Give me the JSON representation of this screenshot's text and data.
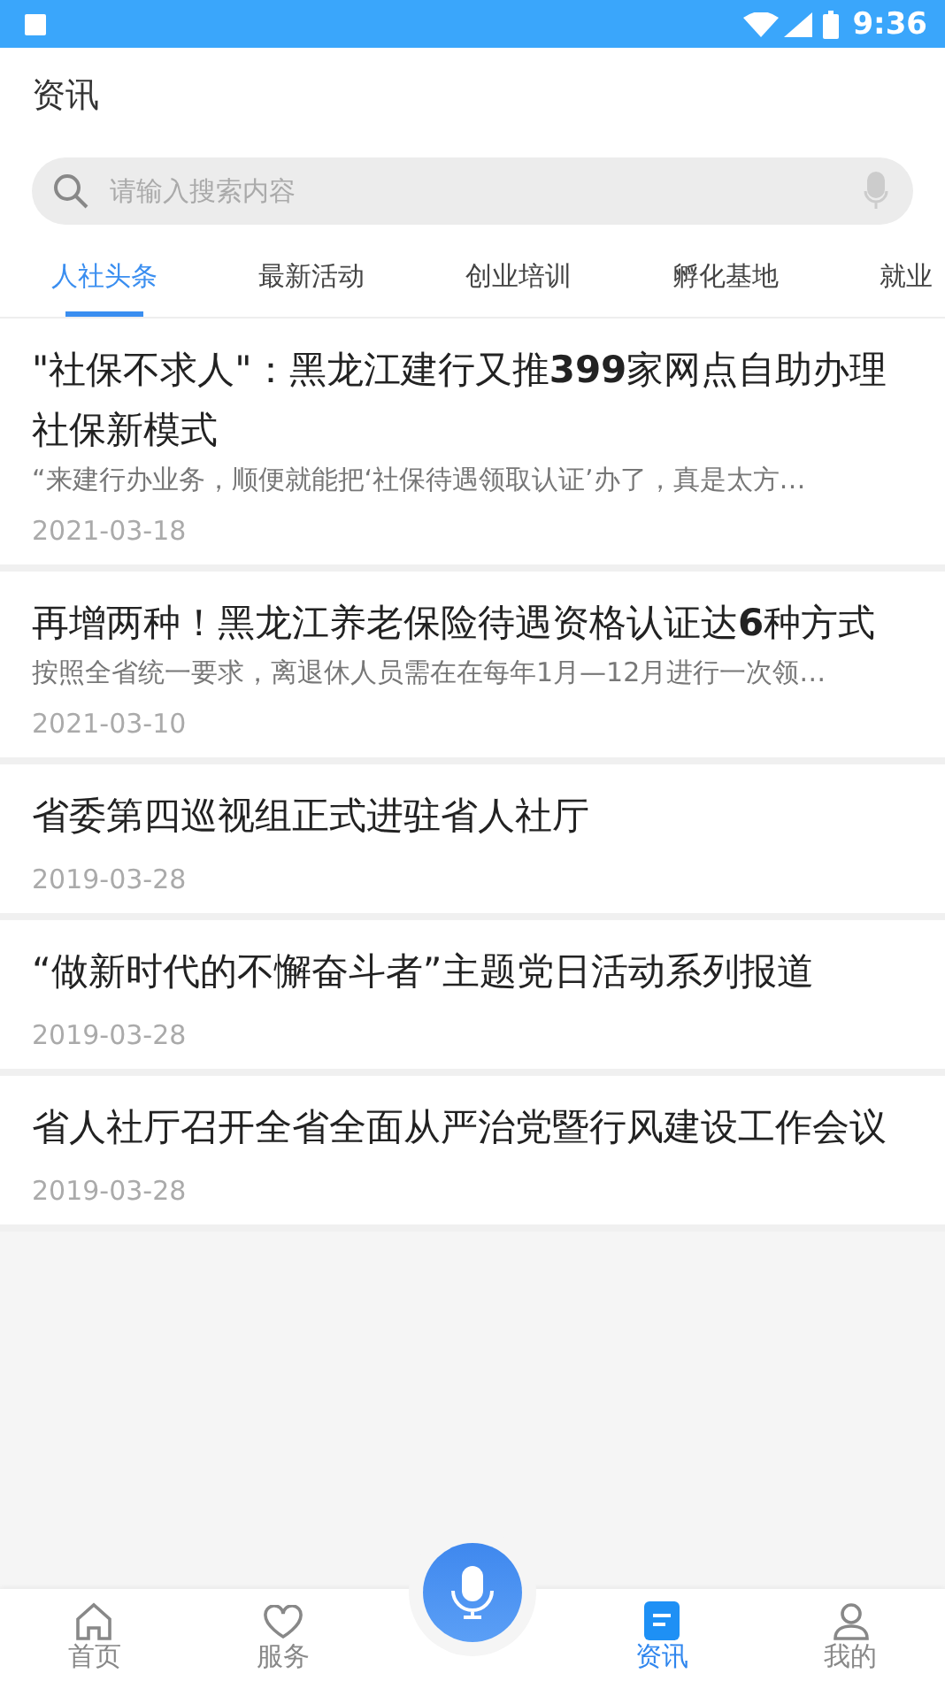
{
  "status_bar": {
    "time": "9:36"
  },
  "header": {
    "title": "资讯"
  },
  "search": {
    "placeholder": "请输入搜索内容"
  },
  "tabs": [
    {
      "label": "人社头条",
      "selected": true
    },
    {
      "label": "最新活动",
      "selected": false
    },
    {
      "label": "创业培训",
      "selected": false
    },
    {
      "label": "孵化基地",
      "selected": false
    },
    {
      "label": "就业",
      "selected": false
    }
  ],
  "articles": [
    {
      "title": "\"社保不求人\"：黑龙江建行又推**399**家网点自助办理社保新模式",
      "snippet": "“来建行办业务，顺便就能把‘社保待遇领取认证’办了，真是太方…",
      "date": "2021-03-18"
    },
    {
      "title": "再增两种！黑龙江养老保险待遇资格认证达**6**种方式",
      "snippet": "按照全省统一要求，离退休人员需在在每年1月—12月进行一次领…",
      "date": "2021-03-10"
    },
    {
      "title": "省委第四巡视组正式进驻省人社厅",
      "date": "2019-03-28"
    },
    {
      "title": "“做新时代的不懈奋斗者”主题党日活动系列报道",
      "date": "2019-03-28"
    },
    {
      "title": "省人社厅召开全省全面从严治党暨行风建设工作会议",
      "date": "2019-03-28"
    }
  ],
  "nav": [
    {
      "kind": "home",
      "label": "首页",
      "selected": false
    },
    {
      "kind": "heart",
      "label": "服务",
      "selected": false
    },
    {
      "kind": "voice"
    },
    {
      "kind": "news",
      "label": "资讯",
      "selected": true
    },
    {
      "kind": "user",
      "label": "我的",
      "selected": false
    }
  ]
}
